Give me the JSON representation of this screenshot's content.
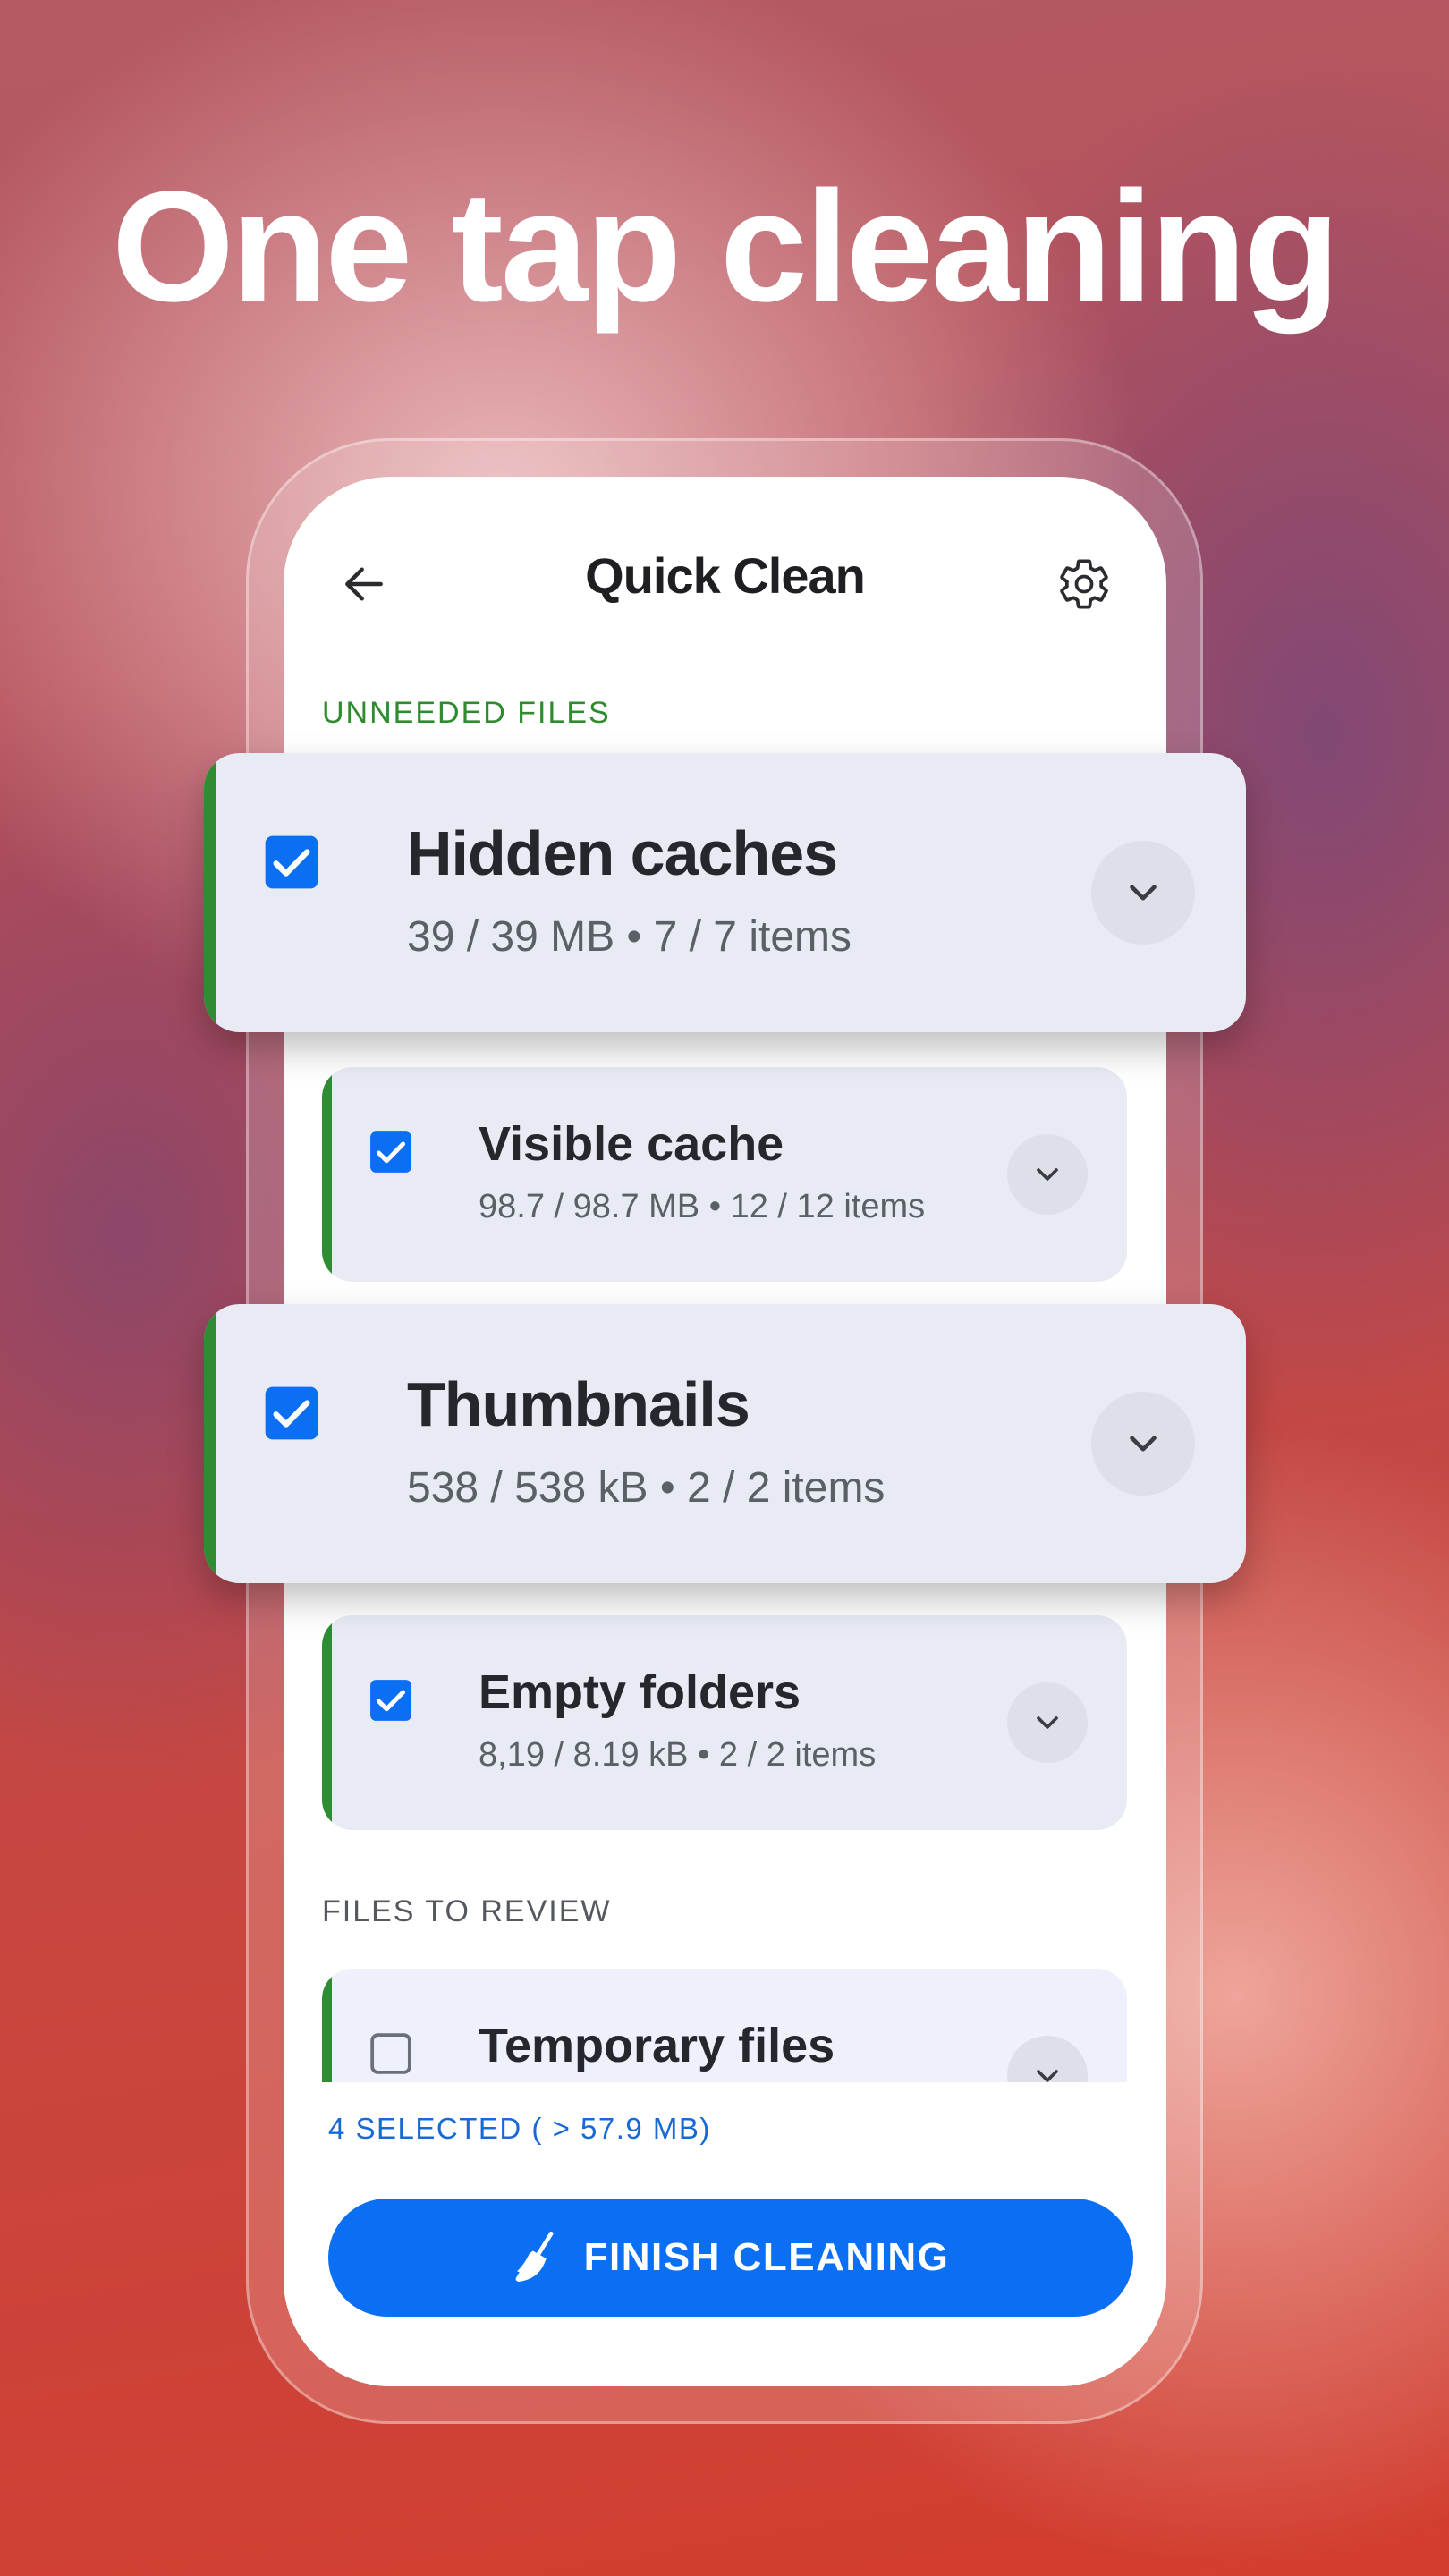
{
  "headline": "One tap cleaning",
  "screen": {
    "title": "Quick Clean",
    "back_icon": "arrow-left-icon",
    "settings_icon": "gear-icon"
  },
  "sections": {
    "unneeded": "UNNEEDED FILES",
    "review": "FILES TO REVIEW"
  },
  "items": {
    "hidden_caches": {
      "title": "Hidden caches",
      "sub": "39 / 39 MB • 7 / 7 items",
      "checked": true
    },
    "visible_cache": {
      "title": "Visible cache",
      "sub": "98.7 / 98.7 MB • 12 / 12 items",
      "checked": true
    },
    "thumbnails": {
      "title": "Thumbnails",
      "sub": "538 / 538 kB • 2 / 2 items",
      "checked": true
    },
    "empty_folders": {
      "title": "Empty folders",
      "sub": "8,19 / 8.19 kB • 2 / 2 items",
      "checked": true
    },
    "temporary_files": {
      "title": "Temporary files",
      "checked": false
    }
  },
  "footer": {
    "selected": "4 SELECTED ( > 57.9 MB)",
    "finish_button": "FINISH CLEANING",
    "finish_icon": "broom-icon"
  },
  "colors": {
    "accent": "#0a6ff2",
    "section_green": "#2e8b2e",
    "stripe_green": "#2f8c33",
    "card_bg": "#e8ebf4"
  }
}
